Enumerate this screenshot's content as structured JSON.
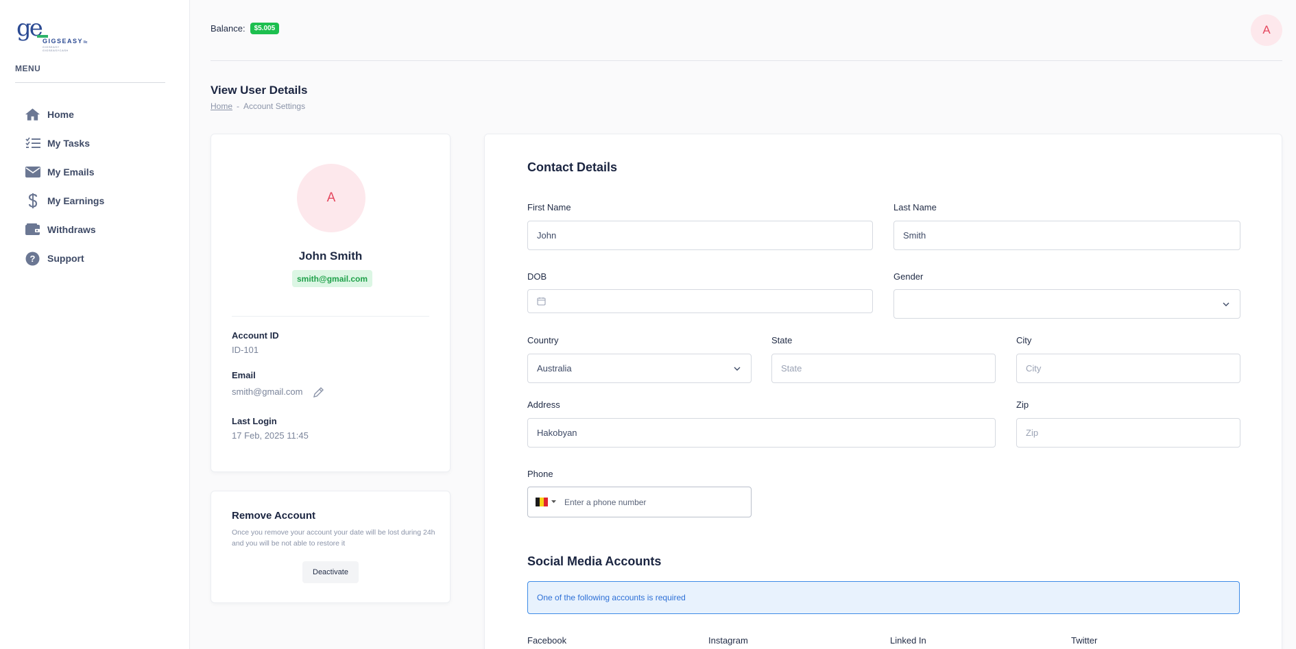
{
  "brand": {
    "mark": "ge",
    "word": "GIGSEASY",
    "word_suffix": "llc",
    "tagline": "GIGSEASY GIGSEASYCASH"
  },
  "sidebar": {
    "menu_label": "MENU",
    "items": [
      {
        "label": "Home",
        "icon": "home-icon"
      },
      {
        "label": "My Tasks",
        "icon": "tasks-icon"
      },
      {
        "label": "My Emails",
        "icon": "mail-icon"
      },
      {
        "label": "My Earnings",
        "icon": "dollar-icon"
      },
      {
        "label": "Withdraws",
        "icon": "wallet-icon"
      },
      {
        "label": "Support",
        "icon": "help-icon"
      }
    ]
  },
  "topbar": {
    "balance_label": "Balance:",
    "balance_value": "$5.005",
    "avatar_initial": "A"
  },
  "page": {
    "title": "View User Details",
    "breadcrumb": {
      "home": "Home",
      "separator": "-",
      "current": "Account Settings"
    }
  },
  "profile": {
    "avatar_initial": "A",
    "name": "John Smith",
    "email_badge": "smith@gmail.com",
    "account_id_label": "Account ID",
    "account_id": "ID-101",
    "email_label": "Email",
    "email": "smith@gmail.com",
    "last_login_label": "Last Login",
    "last_login": "17 Feb, 2025 11:45"
  },
  "remove": {
    "title": "Remove Account",
    "description": "Once you remove your account your date will be lost during 24h and you will be not able to restore it",
    "button": "Deactivate"
  },
  "contact": {
    "title": "Contact Details",
    "first_name": {
      "label": "First Name",
      "value": "John"
    },
    "last_name": {
      "label": "Last Name",
      "value": "Smith"
    },
    "dob": {
      "label": "DOB",
      "value": ""
    },
    "gender": {
      "label": "Gender",
      "value": ""
    },
    "country": {
      "label": "Country",
      "value": "Australia"
    },
    "state": {
      "label": "State",
      "placeholder": "State"
    },
    "city": {
      "label": "City",
      "placeholder": "City"
    },
    "address": {
      "label": "Address",
      "value": "Hakobyan"
    },
    "zip": {
      "label": "Zip",
      "placeholder": "Zip"
    },
    "phone": {
      "label": "Phone",
      "placeholder": "Enter a phone number",
      "flag_colors": [
        "#1a1a1a",
        "#f7d117",
        "#e0252f"
      ]
    }
  },
  "social": {
    "title": "Social Media Accounts",
    "notice": "One of the following accounts is required",
    "columns": [
      "Facebook",
      "Instagram",
      "Linked In",
      "Twitter"
    ]
  },
  "colors": {
    "accent_green": "#1dbf4f",
    "avatar_bg": "#fde8ec",
    "avatar_fg": "#e5485f",
    "info_blue": "#3b8ae6"
  }
}
